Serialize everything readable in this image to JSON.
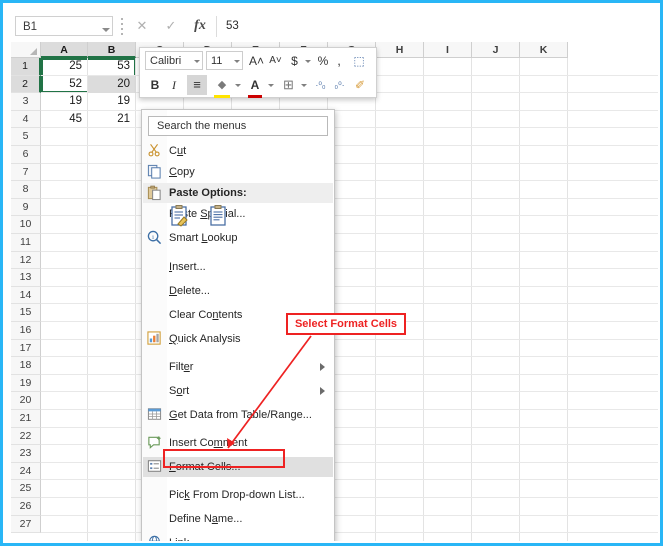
{
  "window": {
    "border_color": "#29b6f6",
    "accent_green": "#217346",
    "annotation_color": "#ee2222"
  },
  "formula_bar": {
    "name_box_value": "B1",
    "name_box_icon": "chevron-down-icon",
    "cancel_icon": "✕",
    "enter_icon": "✓",
    "function_icon": "fx",
    "value": "53"
  },
  "grid": {
    "corner_icon": "select-all-icon",
    "columns": [
      "A",
      "B",
      "C",
      "D",
      "E",
      "F",
      "G",
      "H",
      "I",
      "J",
      "K"
    ],
    "selected_columns": [
      "A",
      "B"
    ],
    "rows": [
      1,
      2,
      3,
      4,
      5,
      6,
      7,
      8,
      9,
      10,
      11,
      12,
      13,
      14,
      15,
      16,
      17,
      18,
      19,
      20,
      21,
      22,
      23,
      24,
      25,
      26,
      27
    ],
    "selected_rows": [
      1,
      2
    ],
    "data": [
      {
        "row": 1,
        "A": "25",
        "B": "53"
      },
      {
        "row": 2,
        "A": "52",
        "B": "20"
      },
      {
        "row": 3,
        "A": "19",
        "B": "19"
      },
      {
        "row": 4,
        "A": "45",
        "B": "21"
      }
    ],
    "selection_range": "A1:B2",
    "active_cell": "B1"
  },
  "mini_toolbar": {
    "font_name": "Calibri",
    "font_size": "11",
    "buttons": [
      {
        "name": "grow-font-icon",
        "label": "A˄"
      },
      {
        "name": "shrink-font-icon",
        "label": "A˅"
      },
      {
        "name": "accounting-number-format-icon",
        "label": "$"
      },
      {
        "name": "percent-style-icon",
        "label": "%"
      },
      {
        "name": "comma-style-icon",
        "label": ","
      },
      {
        "name": "merge-cells-icon",
        "label": "⬚"
      },
      {
        "name": "bold-icon",
        "label": "B"
      },
      {
        "name": "italic-icon",
        "label": "I"
      },
      {
        "name": "align-center-icon",
        "label": "≡"
      },
      {
        "name": "fill-color-icon",
        "label": "◆"
      },
      {
        "name": "font-color-icon",
        "label": "A"
      },
      {
        "name": "borders-icon",
        "label": "⊞"
      },
      {
        "name": "increase-decimal-icon",
        "label": "·⁰₀"
      },
      {
        "name": "decrease-decimal-icon",
        "label": "₀⁰·"
      },
      {
        "name": "format-painter-icon",
        "label": "✐"
      }
    ]
  },
  "context_menu": {
    "search_placeholder": "Search the menus",
    "items": [
      {
        "label": "Cut",
        "icon": "scissors-icon",
        "underline": "u",
        "arrow": false,
        "highlight": false
      },
      {
        "label": "Copy",
        "icon": "copy-icon",
        "underline": "C",
        "arrow": false,
        "highlight": false
      },
      {
        "label": "Paste Options:",
        "icon": "paste-icon",
        "header": true,
        "arrow": false,
        "highlight": false
      },
      {
        "label": "Paste Special...",
        "icon": "",
        "underline": "S",
        "arrow": false,
        "highlight": false
      },
      {
        "label": "Smart Lookup",
        "icon": "smart-lookup-icon",
        "underline": "L",
        "arrow": false,
        "highlight": false
      },
      {
        "label": "Insert...",
        "icon": "",
        "underline": "I",
        "arrow": false,
        "highlight": false
      },
      {
        "label": "Delete...",
        "icon": "",
        "underline": "D",
        "arrow": false,
        "highlight": false
      },
      {
        "label": "Clear Contents",
        "icon": "",
        "underline": "n",
        "arrow": false,
        "highlight": false
      },
      {
        "label": "Quick Analysis",
        "icon": "quick-analysis-icon",
        "underline": "Q",
        "arrow": false,
        "highlight": false
      },
      {
        "label": "Filter",
        "icon": "",
        "underline": "e",
        "arrow": true,
        "highlight": false
      },
      {
        "label": "Sort",
        "icon": "",
        "underline": "o",
        "arrow": true,
        "highlight": false
      },
      {
        "label": "Get Data from Table/Range...",
        "icon": "table-icon",
        "underline": "G",
        "arrow": false,
        "highlight": false
      },
      {
        "label": "Insert Comment",
        "icon": "comment-icon",
        "underline": "m",
        "arrow": false,
        "highlight": false
      },
      {
        "label": "Format Cells...",
        "icon": "format-cells-icon",
        "underline": "F",
        "arrow": false,
        "highlight": true
      },
      {
        "label": "Pick From Drop-down List...",
        "icon": "",
        "underline": "k",
        "arrow": false,
        "highlight": false
      },
      {
        "label": "Define Name...",
        "icon": "",
        "underline": "a",
        "arrow": false,
        "highlight": false
      },
      {
        "label": "Link",
        "icon": "link-icon",
        "underline": "i",
        "arrow": false,
        "highlight": false
      }
    ],
    "paste_option_icons": [
      "paste-values-icon",
      "paste-keep-formatting-icon"
    ]
  },
  "annotation": {
    "text": "Select Format Cells",
    "arrow": "red-arrow-pointer"
  }
}
